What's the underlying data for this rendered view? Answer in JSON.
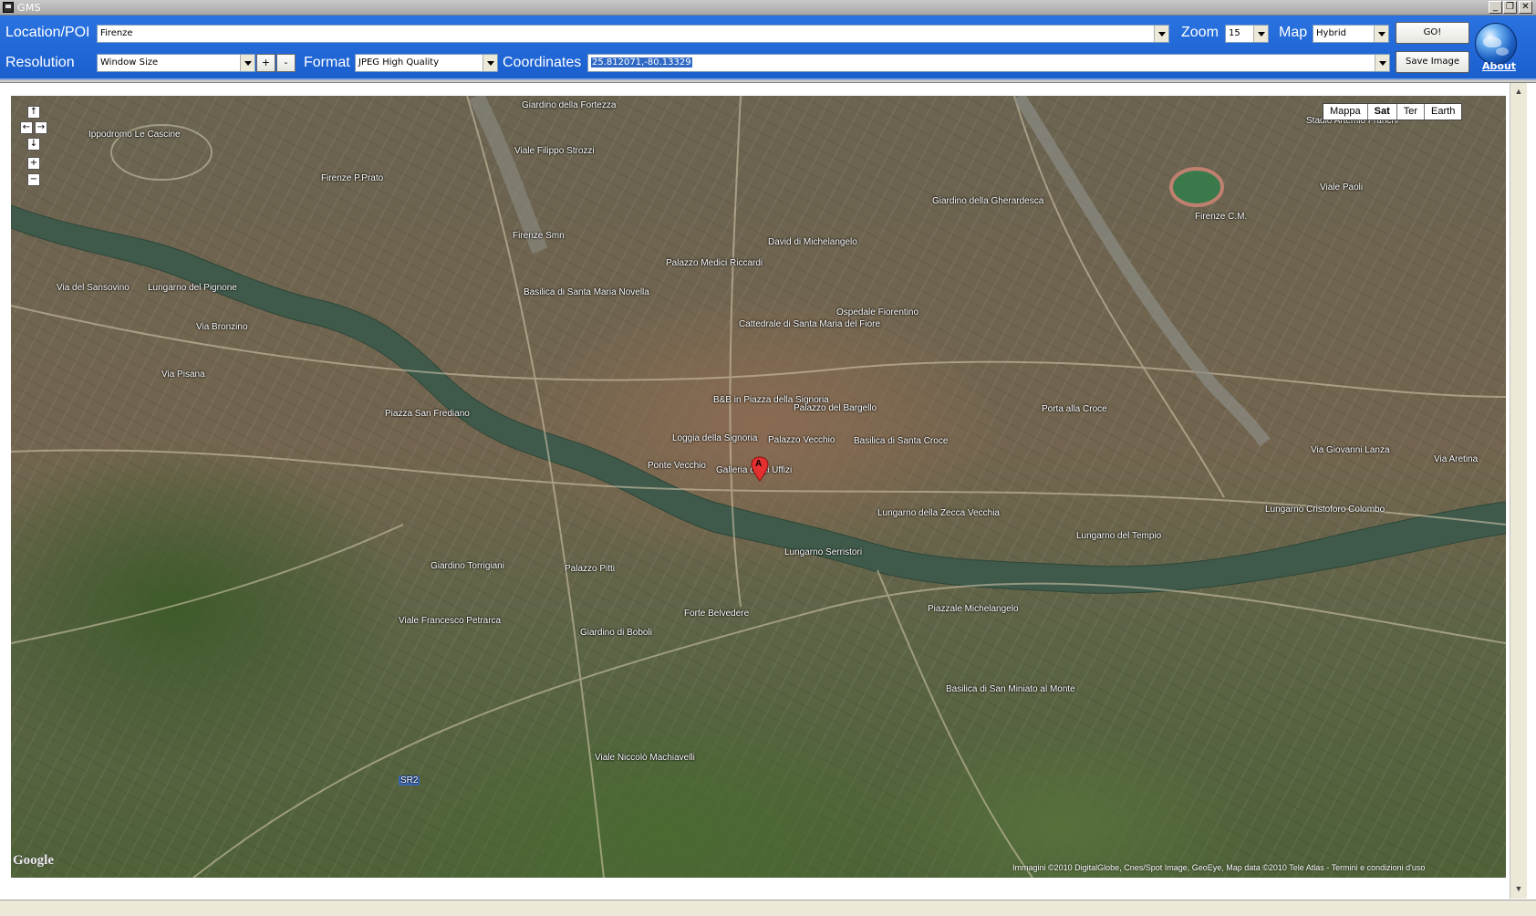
{
  "window": {
    "title": "GMS"
  },
  "toolbar": {
    "location_label": "Location/POI",
    "location_value": "Firenze",
    "zoom_label": "Zoom",
    "zoom_value": "15",
    "map_label": "Map",
    "map_value": "Hybrid",
    "go_label": "GO!",
    "resolution_label": "Resolution",
    "resolution_value": "Window Size",
    "plus_label": "+",
    "minus_label": "-",
    "format_label": "Format",
    "format_value": "JPEG High Quality",
    "coordinates_label": "Coordinates",
    "coordinates_value": "25.812071,-80.13329",
    "save_label": "Save Image",
    "about_label": "About"
  },
  "map": {
    "types": [
      {
        "label": "Mappa",
        "active": false
      },
      {
        "label": "Sat",
        "active": true
      },
      {
        "label": "Ter",
        "active": false
      },
      {
        "label": "Earth",
        "active": false
      }
    ],
    "marker_label": "A",
    "google_logo": "Google",
    "copyright": "Immagini ©2010 DigitalGlobe, Cnes/Spot Image, GeoEye, Map data ©2010 Tele Atlas - Termini e condizioni d'uso",
    "labels": [
      "Giardino della Fortezza",
      "Ippodromo Le Cascine",
      "Viale Filippo Strozzi",
      "Firenze P.Prato",
      "Firenze Smn",
      "Palazzo Medici Riccardi",
      "David di Michelangelo",
      "Giardino della Gherardesca",
      "Stadio Artemio Franchi",
      "Firenze C.M.",
      "Basilica di Santa Maria Novella",
      "Cattedrale di Santa Maria del Fiore",
      "Ospedale Fiorentino",
      "B&B in Piazza della Signoria",
      "Palazzo del Bargello",
      "Loggia della Signoria",
      "Palazzo Vecchio",
      "Basilica di Santa Croce",
      "Galleria degli Uffizi",
      "Ponte Vecchio",
      "Porta alla Croce",
      "Piazza San Frediano",
      "Lungarno del Pignone",
      "Lungarno Serristori",
      "Lungarno della Zecca Vecchia",
      "Lungarno del Tempio",
      "Lungarno Cristoforo Colombo",
      "Palazzo Pitti",
      "Giardino Torrigiani",
      "Giardino di Boboli",
      "Forte Belvedere",
      "Piazzale Michelangelo",
      "Basilica di San Miniato al Monte",
      "Viale Francesco Petrarca",
      "Viale Niccolò Machiavelli",
      "SR2",
      "Via Pisana",
      "Via Bronzino",
      "Via del Sansovino",
      "Via Giovanni Lanza",
      "Via Aretina",
      "Viale Paoli"
    ]
  }
}
